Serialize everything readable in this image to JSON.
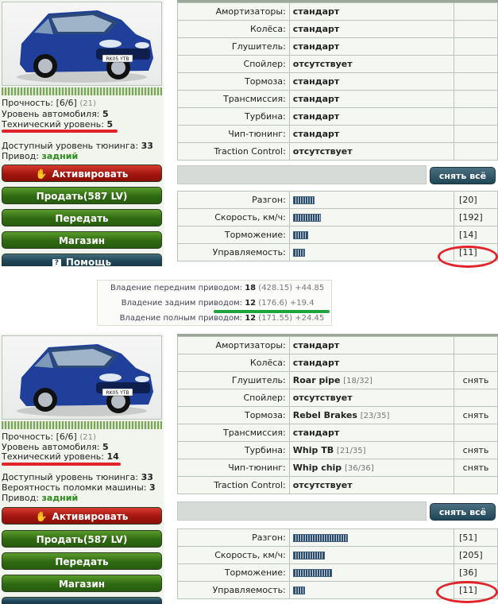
{
  "top": {
    "stats": {
      "strength": {
        "label": "Прочность:",
        "value": "[6/6]",
        "note": "(21)"
      },
      "car_level": {
        "label": "Уровень автомобиля:",
        "value": "5"
      },
      "tech_level": {
        "label": "Технический уровень:",
        "value": "5"
      },
      "tuning_level": {
        "label": "Доступный уровень тюнинга:",
        "value": "33"
      },
      "drive": {
        "label": "Привод:",
        "value": "задний"
      }
    },
    "buttons": {
      "activate": "Активировать",
      "sell": "Продать(587 LV)",
      "transfer": "Передать",
      "shop": "Магазин",
      "help": "Помощь"
    },
    "parts": [
      {
        "label": "Амортизаторы:",
        "value": "стандарт",
        "sub": "",
        "action": ""
      },
      {
        "label": "Колёса:",
        "value": "стандарт",
        "sub": "",
        "action": ""
      },
      {
        "label": "Глушитель:",
        "value": "стандарт",
        "sub": "",
        "action": ""
      },
      {
        "label": "Спойлер:",
        "value": "отсутствует",
        "sub": "",
        "action": ""
      },
      {
        "label": "Тормоза:",
        "value": "стандарт",
        "sub": "",
        "action": ""
      },
      {
        "label": "Трансмиссия:",
        "value": "стандарт",
        "sub": "",
        "action": ""
      },
      {
        "label": "Турбина:",
        "value": "стандарт",
        "sub": "",
        "action": ""
      },
      {
        "label": "Чип-тюнинг:",
        "value": "стандарт",
        "sub": "",
        "action": ""
      },
      {
        "label": "Traction Control:",
        "value": "отсутствует",
        "sub": "",
        "action": ""
      }
    ],
    "remove_all": "снять всё",
    "performance": [
      {
        "label": "Разгон:",
        "value": "[20]",
        "bars": 20
      },
      {
        "label": "Скорость, км/ч:",
        "value": "[192]",
        "bars": 192
      },
      {
        "label": "Торможение:",
        "value": "[14]",
        "bars": 14
      },
      {
        "label": "Управляемость:",
        "value": "[11]",
        "bars": 11
      }
    ]
  },
  "ownership": [
    {
      "label": "Владение передним приводом:",
      "value": "18",
      "sub": "(428.15) +44.85"
    },
    {
      "label": "Владение задним приводом:",
      "value": "12",
      "sub": "(176.6) +19.4"
    },
    {
      "label": "Владение полным приводом:",
      "value": "12",
      "sub": "(171.55) +24.45"
    }
  ],
  "bottom": {
    "stats": {
      "strength": {
        "label": "Прочность:",
        "value": "[6/6]",
        "note": "(21)"
      },
      "car_level": {
        "label": "Уровень автомобиля:",
        "value": "5"
      },
      "tech_level": {
        "label": "Технический уровень:",
        "value": "14"
      },
      "tuning_level": {
        "label": "Доступный уровень тюнинга:",
        "value": "33"
      },
      "breakdown": {
        "label": "Вероятность поломки машины:",
        "value": "3"
      },
      "drive": {
        "label": "Привод:",
        "value": "задний"
      }
    },
    "buttons": {
      "activate": "Активировать",
      "sell": "Продать(587 LV)",
      "transfer": "Передать",
      "shop": "Магазин"
    },
    "parts": [
      {
        "label": "Амортизаторы:",
        "value": "стандарт",
        "sub": "",
        "action": ""
      },
      {
        "label": "Колёса:",
        "value": "стандарт",
        "sub": "",
        "action": ""
      },
      {
        "label": "Глушитель:",
        "value": "Roar pipe",
        "sub": "[18/32]",
        "action": "снять"
      },
      {
        "label": "Спойлер:",
        "value": "отсутствует",
        "sub": "",
        "action": ""
      },
      {
        "label": "Тормоза:",
        "value": "Rebel Brakes",
        "sub": "[23/35]",
        "action": "снять"
      },
      {
        "label": "Трансмиссия:",
        "value": "стандарт",
        "sub": "",
        "action": ""
      },
      {
        "label": "Турбина:",
        "value": "Whip TB",
        "sub": "[21/35]",
        "action": "снять"
      },
      {
        "label": "Чип-тюнинг:",
        "value": "Whip chip",
        "sub": "[36/36]",
        "action": "снять"
      },
      {
        "label": "Traction Control:",
        "value": "отсутствует",
        "sub": "",
        "action": ""
      }
    ],
    "remove_all": "снять всё",
    "performance": [
      {
        "label": "Разгон:",
        "value": "[51]",
        "bars": 51
      },
      {
        "label": "Скорость, км/ч:",
        "value": "[205]",
        "bars": 205
      },
      {
        "label": "Торможение:",
        "value": "[36]",
        "bars": 36
      },
      {
        "label": "Управляемость:",
        "value": "[11]",
        "bars": 11
      }
    ]
  },
  "car_plate": "RK05 YTB",
  "colors": {
    "accent_red": "#e0242a",
    "accent_green": "#1ea33e",
    "drive_green": "#2e8b1e"
  }
}
